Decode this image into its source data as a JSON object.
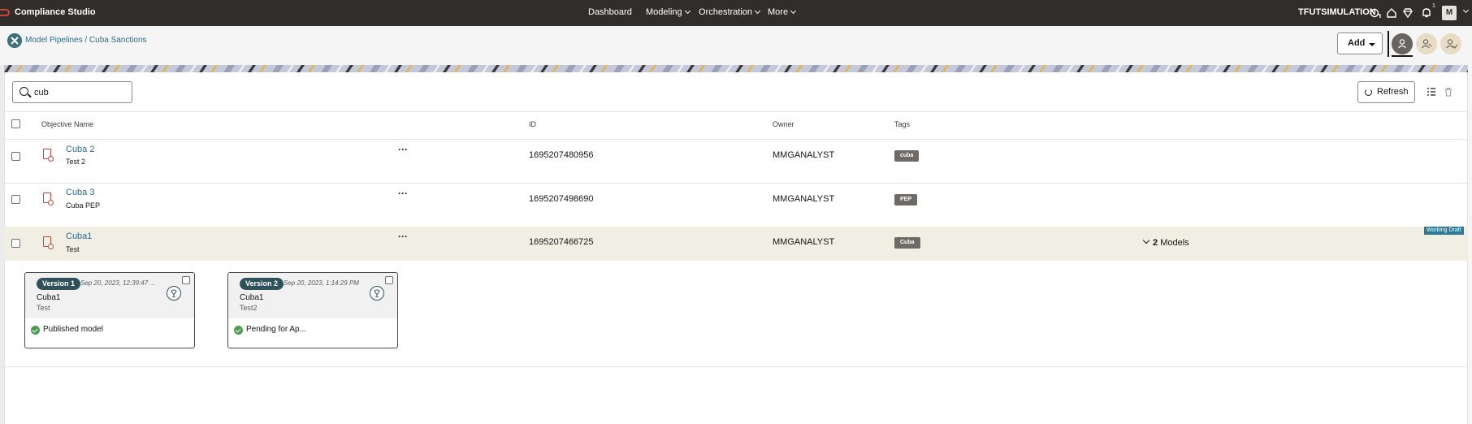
{
  "app": {
    "name": "Compliance Studio"
  },
  "topnav": {
    "items": [
      {
        "label": "Dashboard",
        "dropdown": false
      },
      {
        "label": "Modeling",
        "dropdown": true
      },
      {
        "label": "Orchestration",
        "dropdown": true
      },
      {
        "label": "More",
        "dropdown": true
      }
    ],
    "tenant": "TFUTSIMULATION",
    "notification_count": "1",
    "user_initial": "M"
  },
  "breadcrumb": {
    "text": "Model Pipelines / Cuba Sanctions"
  },
  "toolbar": {
    "add_label": "Add",
    "refresh_label": "Refresh"
  },
  "search": {
    "value": "cub",
    "placeholder": ""
  },
  "table": {
    "columns": {
      "name": "Objective Name",
      "id": "ID",
      "owner": "Owner",
      "tags": "Tags"
    },
    "rows": [
      {
        "name": "Cuba 2",
        "description": "Test 2",
        "id": "1695207480956",
        "owner": "MMGANALYST",
        "tag": "cuba"
      },
      {
        "name": "Cuba 3",
        "description": "Cuba PEP",
        "id": "1695207498690",
        "owner": "MMGANALYST",
        "tag": "PEP"
      },
      {
        "name": "Cuba1",
        "description": "Test",
        "id": "1695207466725",
        "owner": "MMGANALYST",
        "tag": "Cuba",
        "models_count": "2",
        "models_label": "Models",
        "badge": "Working Draft"
      }
    ],
    "more_label": "···"
  },
  "versions": [
    {
      "badge": "Version 1",
      "date": "Sep 20, 2023, 12:39:47 ...",
      "name": "Cuba1",
      "description": "Test",
      "status": "Published model"
    },
    {
      "badge": "Version 2",
      "date": "Sep 20, 2023, 1:14:29 PM",
      "name": "Cuba1",
      "description": "Test2",
      "status": "Pending for Ap..."
    }
  ],
  "colors": {
    "topbar": "#312d2a",
    "link": "#2d6a8c",
    "tag": "#6f6a65",
    "badge": "#2f525a",
    "highlight_row": "#f1eee3",
    "status_ok": "#4e9a4e"
  }
}
